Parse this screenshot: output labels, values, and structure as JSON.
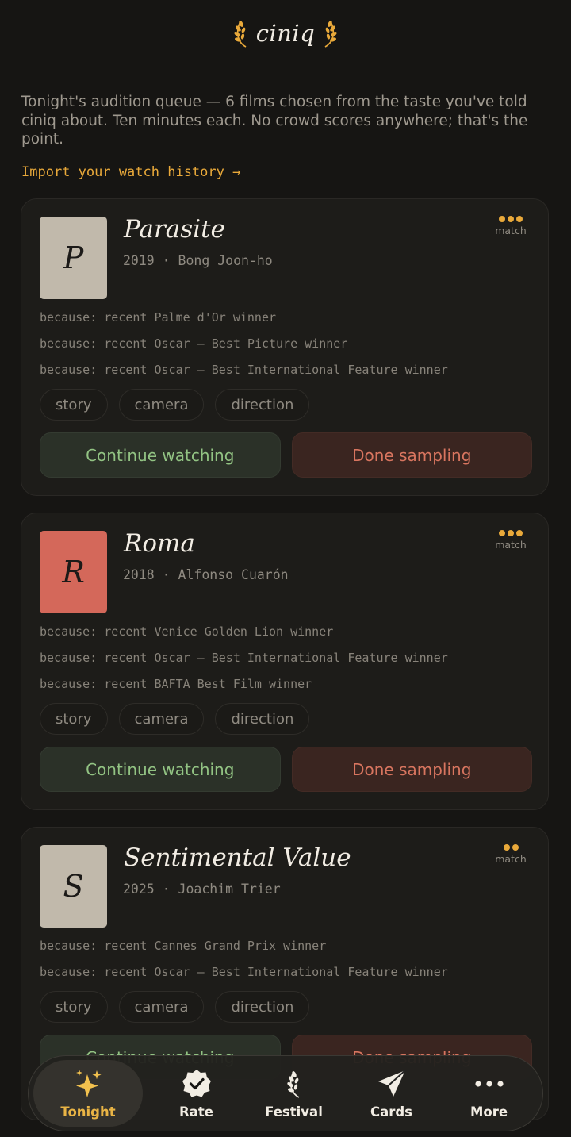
{
  "app": {
    "name": "ciniq",
    "intro": "Tonight's audition queue — 6 films chosen from the taste you've told ciniq about. Ten minutes each. No crowd scores anywhere; that's the point.",
    "import_link": "Import your watch history →"
  },
  "colors": {
    "accent": "#e9a93a",
    "background": "#161513",
    "card": "#1d1c19",
    "continue_text": "#92c383",
    "done_text": "#d8755f"
  },
  "films": [
    {
      "poster_letter": "P",
      "poster_color": "#c1b9ab",
      "title": "Parasite",
      "meta": "2019 · Bong Joon-ho",
      "match_dots": 3,
      "match_label": "match",
      "because": [
        "because: recent Palme d'Or winner",
        "because: recent Oscar – Best Picture winner",
        "because: recent Oscar – Best International Feature winner"
      ],
      "tags": [
        "story",
        "camera",
        "direction"
      ],
      "continue_label": "Continue watching",
      "done_label": "Done sampling"
    },
    {
      "poster_letter": "R",
      "poster_color": "#d4685a",
      "title": "Roma",
      "meta": "2018 · Alfonso Cuarón",
      "match_dots": 3,
      "match_label": "match",
      "because": [
        "because: recent Venice Golden Lion winner",
        "because: recent Oscar – Best International Feature winner",
        "because: recent BAFTA Best Film winner"
      ],
      "tags": [
        "story",
        "camera",
        "direction"
      ],
      "continue_label": "Continue watching",
      "done_label": "Done sampling"
    },
    {
      "poster_letter": "S",
      "poster_color": "#c1b9ab",
      "title": "Sentimental Value",
      "meta": "2025 · Joachim Trier",
      "match_dots": 2,
      "match_label": "match",
      "because": [
        "because: recent Cannes Grand Prix winner",
        "because: recent Oscar – Best International Feature winner"
      ],
      "tags": [
        "story",
        "camera",
        "direction"
      ],
      "continue_label": "Continue watching",
      "done_label": "Done sampling"
    }
  ],
  "nav": [
    {
      "label": "Tonight",
      "icon": "sparkles-icon",
      "active": true
    },
    {
      "label": "Rate",
      "icon": "verified-check-icon",
      "active": false
    },
    {
      "label": "Festival",
      "icon": "laurel-icon",
      "active": false
    },
    {
      "label": "Cards",
      "icon": "send-icon",
      "active": false
    },
    {
      "label": "More",
      "icon": "more-dots-icon",
      "active": false
    }
  ]
}
